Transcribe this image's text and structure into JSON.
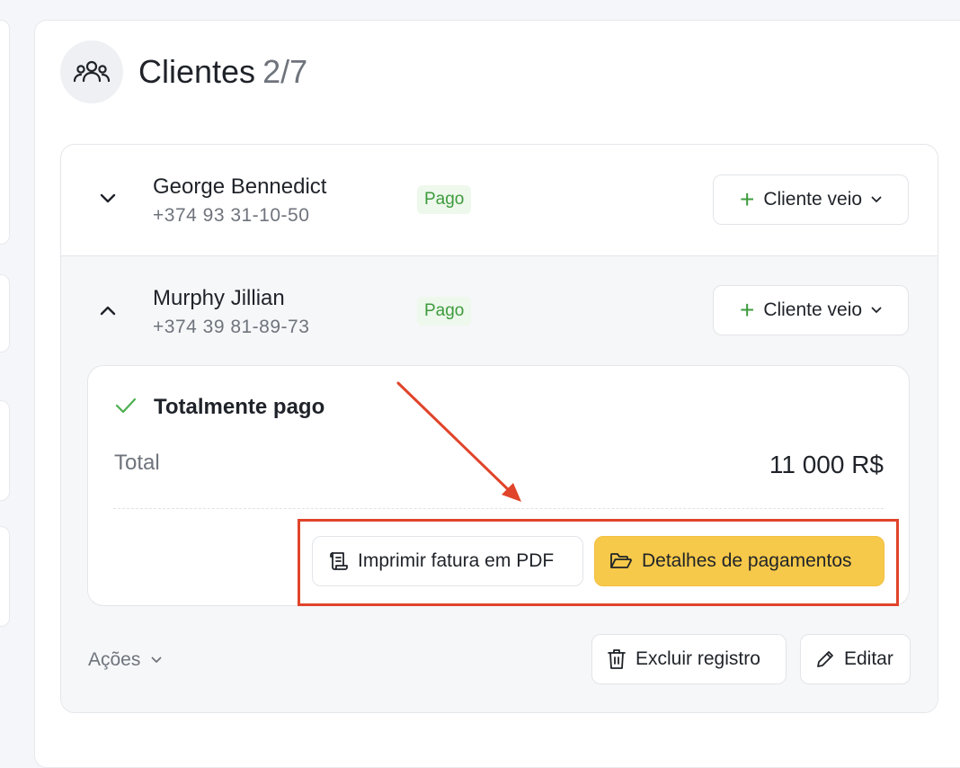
{
  "header": {
    "title": "Clientes",
    "count": "2/7",
    "icon": "users-icon"
  },
  "clients": [
    {
      "name": "George Bennedict",
      "phone": "+374 93 31-10-50",
      "badge": "Pago",
      "status_button": "Cliente veio",
      "expanded": false
    },
    {
      "name": "Murphy Jillian",
      "phone": "+374 39 81-89-73",
      "badge": "Pago",
      "status_button": "Cliente veio",
      "expanded": true
    }
  ],
  "details": {
    "status": "Totalmente pago",
    "total_label": "Total",
    "total_value": "11 000 R$",
    "print_pdf_label": "Imprimir fatura em PDF",
    "payment_details_label": "Detalhes de pagamentos"
  },
  "footer": {
    "actions_label": "Ações",
    "delete_label": "Excluir registro",
    "edit_label": "Editar"
  },
  "colors": {
    "accent_yellow": "#f7c94a",
    "paid_green": "#3e9b3e",
    "highlight_red": "#e0442a"
  }
}
